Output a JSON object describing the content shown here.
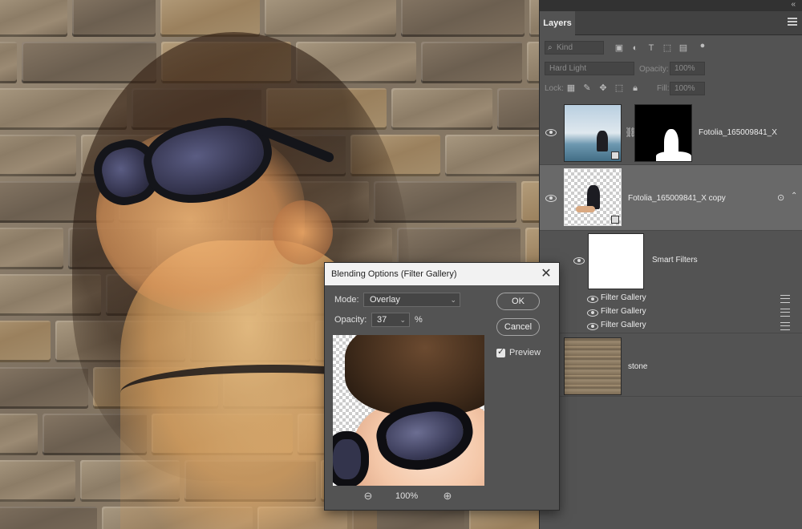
{
  "layers_panel": {
    "tab_label": "Layers",
    "filter_kind": "Kind",
    "blend_mode": "Hard Light",
    "opacity_label": "Opacity:",
    "opacity_value": "100%",
    "lock_label": "Lock:",
    "fill_label": "Fill:",
    "fill_value": "100%",
    "layers": [
      {
        "name": "Fotolia_165009841_X"
      },
      {
        "name": "Fotolia_165009841_X copy"
      },
      {
        "name": "Smart Filters"
      },
      {
        "name": "Filter Gallery"
      },
      {
        "name": "Filter Gallery"
      },
      {
        "name": "Filter Gallery"
      },
      {
        "name": "stone"
      }
    ]
  },
  "dialog": {
    "title": "Blending Options (Filter Gallery)",
    "mode_label": "Mode:",
    "mode_value": "Overlay",
    "opacity_label": "Opacity:",
    "opacity_value": "37",
    "opacity_unit": "%",
    "ok_label": "OK",
    "cancel_label": "Cancel",
    "preview_label": "Preview",
    "preview_checked": true,
    "zoom_value": "100%"
  }
}
